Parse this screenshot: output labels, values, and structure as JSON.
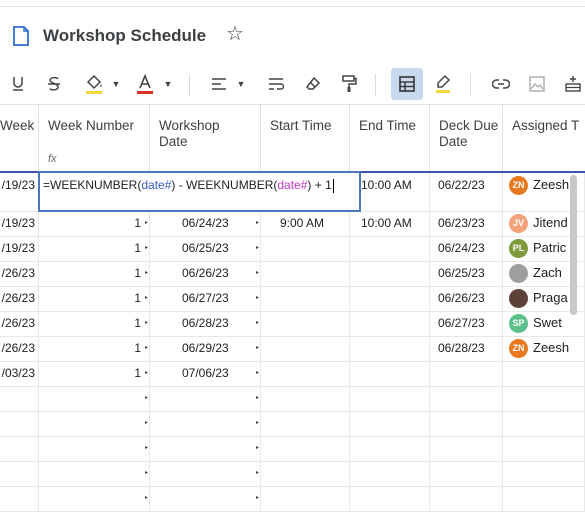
{
  "title": "Workshop Schedule",
  "toolbar": [
    {
      "name": "underline-icon"
    },
    {
      "name": "strikethrough-icon"
    },
    {
      "name": "fill-color-icon"
    },
    {
      "name": "text-color-icon"
    },
    {
      "name": "align-icon"
    },
    {
      "name": "wrap-icon"
    },
    {
      "name": "clear-format-icon"
    },
    {
      "name": "format-painter-icon"
    },
    {
      "name": "grid-view-icon"
    },
    {
      "name": "highlight-icon"
    },
    {
      "name": "link-icon"
    },
    {
      "name": "image-icon"
    },
    {
      "name": "insert-row-icon"
    }
  ],
  "columns": {
    "week": "Week",
    "week_number": "Week Number",
    "workshop_date": "Workshop Date",
    "start_time": "Start Time",
    "end_time": "End Time",
    "deck_due_date": "Deck Due Date",
    "assigned": "Assigned T"
  },
  "formula": {
    "part1": "=WEEKNUMBER(",
    "ref1": "date#",
    "part2": ") - WEEKNUMBER(",
    "ref2": "date#",
    "part3": ") + 1"
  },
  "rows": [
    {
      "week": "/19/23",
      "num": "",
      "date": "",
      "start": "",
      "end": "10:00 AM",
      "deck": "06/22/23",
      "initials": "ZN",
      "name": "Zeesh",
      "color": "#e8791f"
    },
    {
      "week": "/19/23",
      "num": "1",
      "date": "06/24/23",
      "start": "9:00 AM",
      "end": "10:00 AM",
      "deck": "06/23/23",
      "initials": "JV",
      "name": "Jitend",
      "color": "#f4a27c"
    },
    {
      "week": "/19/23",
      "num": "1",
      "date": "06/25/23",
      "start": "",
      "end": "",
      "deck": "06/24/23",
      "initials": "PL",
      "name": "Patric",
      "color": "#7d9a3b"
    },
    {
      "week": "/26/23",
      "num": "1",
      "date": "06/26/23",
      "start": "",
      "end": "",
      "deck": "06/25/23",
      "initials": "",
      "name": "Zach",
      "color": "#9e9e9e"
    },
    {
      "week": "/26/23",
      "num": "1",
      "date": "06/27/23",
      "start": "",
      "end": "",
      "deck": "06/26/23",
      "initials": "",
      "name": "Praga",
      "color": "#5d4037"
    },
    {
      "week": "/26/23",
      "num": "1",
      "date": "06/28/23",
      "start": "",
      "end": "",
      "deck": "06/27/23",
      "initials": "SP",
      "name": "Swet",
      "color": "#5cc08a"
    },
    {
      "week": "/26/23",
      "num": "1",
      "date": "06/29/23",
      "start": "",
      "end": "",
      "deck": "06/28/23",
      "initials": "ZN",
      "name": "Zeesh",
      "color": "#e8791f"
    },
    {
      "week": "/03/23",
      "num": "1",
      "date": "07/06/23",
      "start": "",
      "end": "",
      "deck": "",
      "initials": "",
      "name": "",
      "color": ""
    }
  ]
}
